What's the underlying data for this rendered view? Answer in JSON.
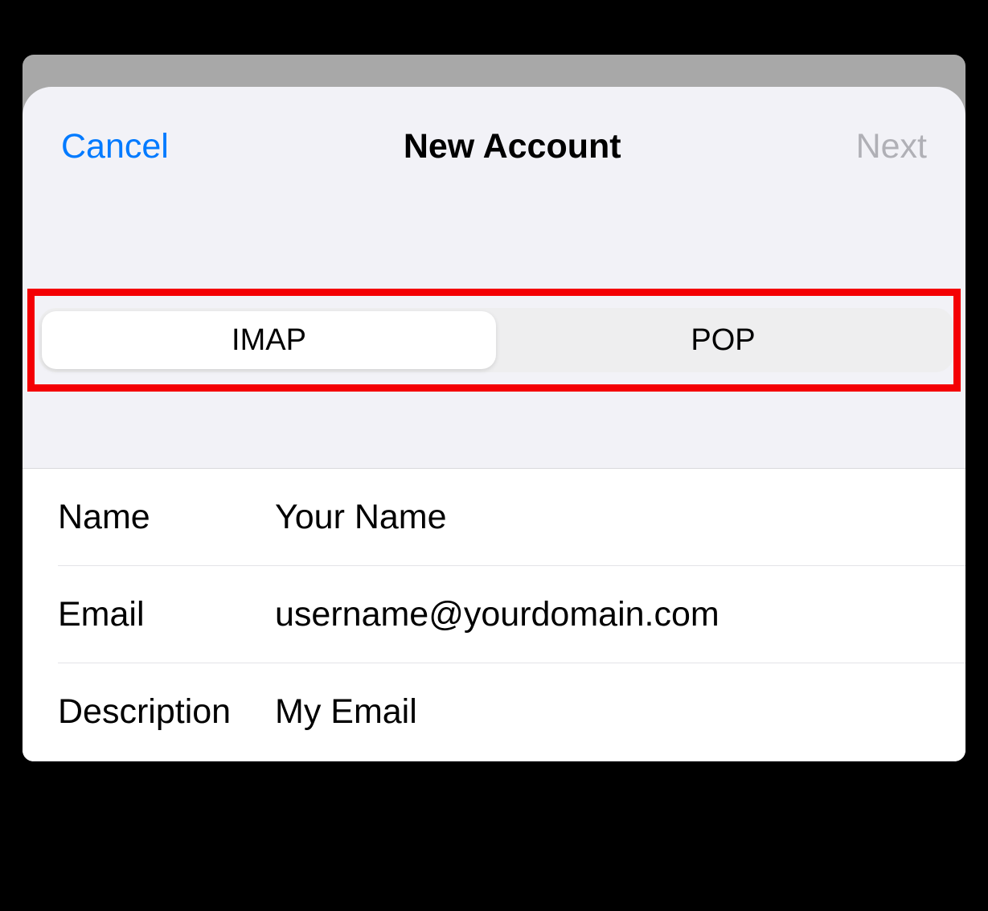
{
  "header": {
    "cancel_label": "Cancel",
    "title": "New Account",
    "next_label": "Next"
  },
  "protocol_selector": {
    "imap_label": "IMAP",
    "pop_label": "POP",
    "selected": "IMAP"
  },
  "form": {
    "name": {
      "label": "Name",
      "value": "Your Name"
    },
    "email": {
      "label": "Email",
      "value": "username@yourdomain.com"
    },
    "description": {
      "label": "Description",
      "value": "My Email"
    }
  }
}
